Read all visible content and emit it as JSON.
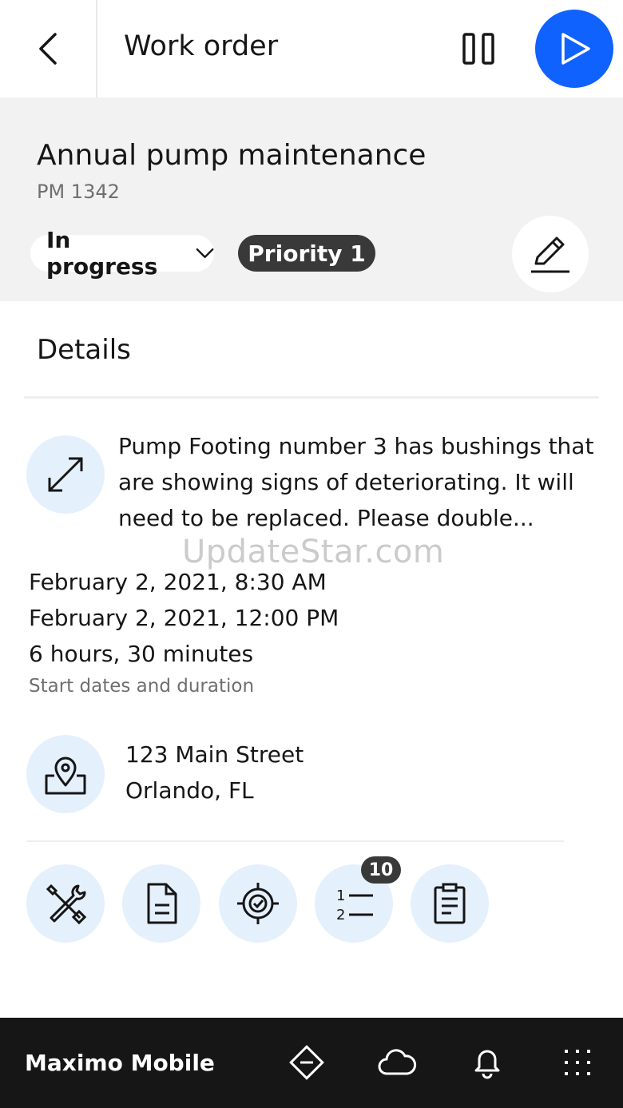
{
  "header": {
    "title": "Work order"
  },
  "work_order": {
    "title": "Annual pump maintenance",
    "id": "PM 1342",
    "status": "In progress",
    "priority": "Priority 1"
  },
  "details": {
    "heading": "Details",
    "description": "Pump Footing number 3 has bushings that are showing signs of deteriorating.  It will need to be replaced.  Please double...",
    "start_date": "February 2, 2021, 8:30 AM",
    "end_date": "February 2, 2021, 12:00 PM",
    "duration": "6 hours, 30 minutes",
    "dates_caption": "Start dates and duration",
    "address_line1": "123 Main Street",
    "address_line2": "Orlando, FL",
    "tasks_count": "10"
  },
  "watermark": "UpdateStar.com",
  "bottom_bar": {
    "brand": "Maximo Mobile"
  },
  "icons": {
    "back": "chevron-left-icon",
    "pause": "pause-icon",
    "play": "play-icon",
    "edit": "pencil-icon",
    "expand": "maximize-icon",
    "location": "location-pin-icon",
    "tools": "tools-icon",
    "document": "document-icon",
    "asset": "target-check-icon",
    "tasks": "list-numbered-icon",
    "report": "clipboard-icon",
    "nav": [
      "map-direction-icon",
      "cloud-icon",
      "bell-icon",
      "app-grid-icon"
    ]
  },
  "colors": {
    "accent": "#0f62fe",
    "circle_bg": "#e5f0fd",
    "dark_chip": "#393939",
    "bottom_bar": "#161616"
  }
}
